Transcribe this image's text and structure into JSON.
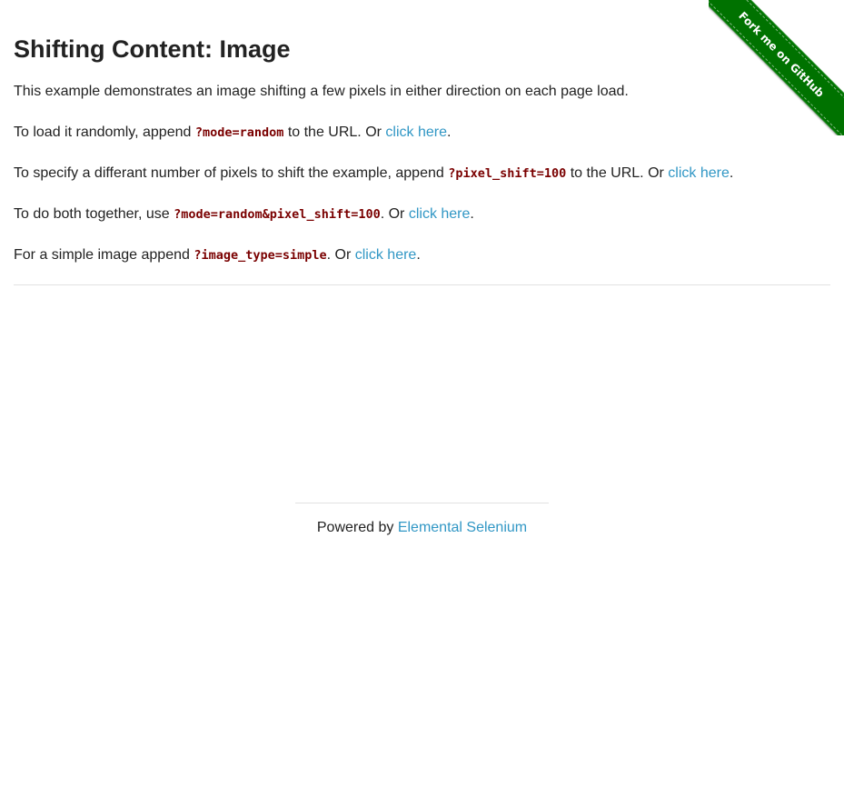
{
  "ribbon": {
    "label": "Fork me on GitHub",
    "color": "#007200"
  },
  "main": {
    "title": "Shifting Content: Image",
    "intro": "This example demonstrates an image shifting a few pixels in either direction on each page load.",
    "random": {
      "prefix": "To load it randomly, append ",
      "code": "?mode=random",
      "middle": " to the URL. Or ",
      "link": "click here",
      "suffix": "."
    },
    "pixel_shift": {
      "prefix": "To specify a differant number of pixels to shift the example, append ",
      "code": "?pixel_shift=100",
      "middle": " to the URL. Or ",
      "link": "click here",
      "suffix": "."
    },
    "both": {
      "prefix": "To do both together, use ",
      "code": "?mode=random&pixel_shift=100",
      "middle": ". Or ",
      "link": "click here",
      "suffix": "."
    },
    "simple": {
      "prefix": "For a simple image append ",
      "code": "?image_type=simple",
      "middle": ". Or ",
      "link": "click here",
      "suffix": "."
    }
  },
  "footer": {
    "prefix": "Powered by ",
    "link": "Elemental Selenium"
  },
  "colors": {
    "link": "#3197c5",
    "code": "#7a0000",
    "text": "#222222"
  }
}
